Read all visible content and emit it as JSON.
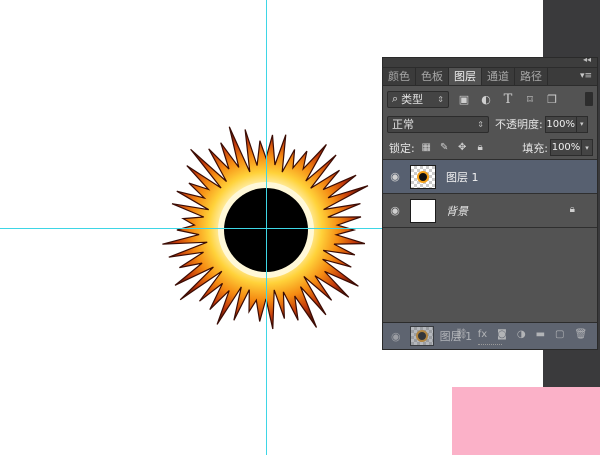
{
  "panel": {
    "tabs": [
      "颜色",
      "色板",
      "图层",
      "通道",
      "路径"
    ],
    "active_tab": 2,
    "collapse_icon": "double-chevron-right-icon",
    "menu_icon": "panel-menu-icon"
  },
  "filter": {
    "search_icon": "⌕",
    "kind_label": "类型",
    "icons": [
      "image-filter-icon",
      "adjustment-filter-icon",
      "type-filter-icon",
      "shape-filter-icon",
      "smart-object-filter-icon"
    ]
  },
  "blend": {
    "mode": "正常",
    "opacity_label": "不透明度:",
    "opacity_value": "100%"
  },
  "locks": {
    "label": "锁定:",
    "fill_label": "填充:",
    "fill_value": "100%"
  },
  "layers": [
    {
      "name": "图层 1",
      "selected": true,
      "visible": true
    },
    {
      "name": "背景",
      "selected": false,
      "visible": true,
      "locked": true
    }
  ],
  "drag_ghost": {
    "name": "图层 1"
  }
}
